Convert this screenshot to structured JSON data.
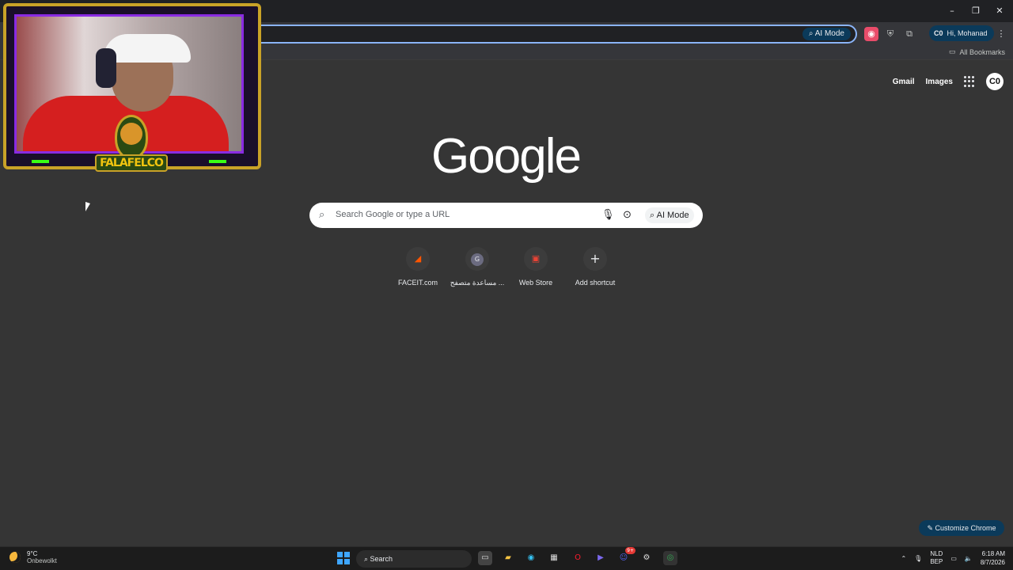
{
  "window": {
    "minimize": "–",
    "restore": "❐",
    "close": "✕"
  },
  "omnibox": {
    "ai_mode": "AI Mode"
  },
  "profile": {
    "greeting": "Hi, Mohanad"
  },
  "bookmarks": {
    "all": "All Bookmarks"
  },
  "ntp": {
    "top_links": {
      "gmail": "Gmail",
      "images": "Images"
    },
    "avatar": "C0",
    "logo": "Google",
    "search": {
      "placeholder": "Search Google or type a URL",
      "ai_mode": "AI Mode"
    },
    "shortcuts": [
      {
        "label": "FACEIT.com",
        "glyph": "◢"
      },
      {
        "label": "مساعدة متصفح ...",
        "glyph": "G"
      },
      {
        "label": "Web Store",
        "glyph": "▣"
      },
      {
        "label": "Add shortcut",
        "glyph": "+"
      }
    ],
    "customize": "Customize Chrome"
  },
  "overlay": {
    "brand": "FALAFELCO"
  },
  "taskbar": {
    "weather": {
      "temp": "9°C",
      "condition": "Onbewolkt"
    },
    "search": "Search",
    "lang": {
      "code": "NLD",
      "variant": "BEP"
    },
    "clock": {
      "time": "6:18 AM",
      "date": "8/7/2026"
    },
    "notification_count": "9+"
  },
  "colors": {
    "accent": "#8ab4f8",
    "chip": "#0b3a5a",
    "background": "#353535"
  },
  "icons": [
    "search-icon",
    "mic-icon",
    "lens-icon",
    "folder-icon",
    "apps-icon",
    "pencil-icon",
    "windows-start-icon"
  ]
}
